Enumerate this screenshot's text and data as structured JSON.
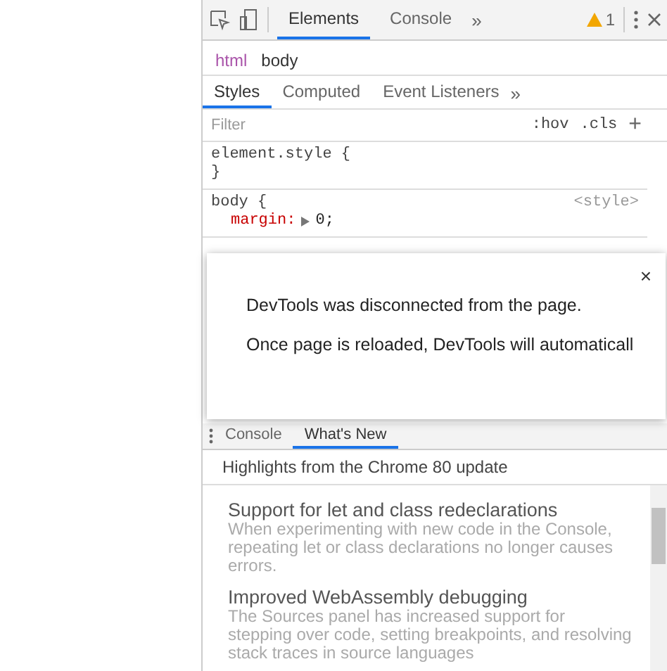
{
  "toolbar": {
    "tabs": [
      {
        "label": "Elements",
        "selected": true
      },
      {
        "label": "Console",
        "selected": false
      }
    ],
    "more": "»",
    "warning_count": "1"
  },
  "breadcrumbs": [
    {
      "label": "html",
      "selected": true
    },
    {
      "label": "body",
      "selected": false
    }
  ],
  "style_tabs": [
    {
      "label": "Styles",
      "selected": true
    },
    {
      "label": "Computed",
      "selected": false
    },
    {
      "label": "Event Listeners",
      "selected": false
    }
  ],
  "style_tabs_more": "»",
  "filter": {
    "placeholder": "Filter",
    "hov": ":hov",
    "cls": ".cls",
    "add": "+"
  },
  "rules": [
    {
      "selector": "element.style {",
      "close": "}"
    },
    {
      "selector": "body {",
      "source": "<style>",
      "props": [
        {
          "name": "margin:",
          "value": "0;"
        }
      ]
    }
  ],
  "dialog": {
    "close": "×",
    "messages": [
      "DevTools was disconnected from the page.",
      "Once page is reloaded, DevTools will automaticall"
    ]
  },
  "drawer": {
    "tabs": [
      {
        "label": "Console",
        "selected": false
      },
      {
        "label": "What's New",
        "selected": true
      }
    ],
    "header": "Highlights from the Chrome 80 update",
    "items": [
      {
        "title": "Support for let and class redeclarations",
        "text": "When experimenting with new code in the Console, repeating let or class declarations no longer causes errors."
      },
      {
        "title": "Improved WebAssembly debugging",
        "text": "The Sources panel has increased support for stepping over code, setting breakpoints, and resolving stack traces in source languages"
      }
    ]
  }
}
